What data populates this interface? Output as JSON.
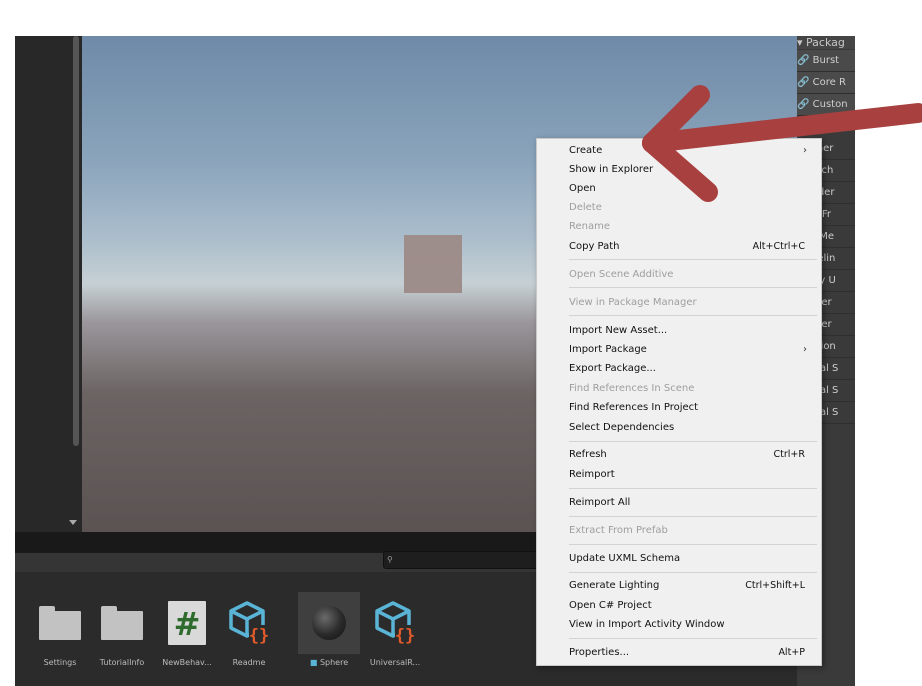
{
  "assets": [
    {
      "label": "Settings",
      "kind": "folder"
    },
    {
      "label": "TutorialInfo",
      "kind": "folder"
    },
    {
      "label": "NewBehav...",
      "kind": "script"
    },
    {
      "label": "Readme",
      "kind": "package"
    },
    {
      "label": "Sphere",
      "kind": "sphere"
    },
    {
      "label": "UniversalR...",
      "kind": "package"
    }
  ],
  "right_panel": {
    "header": "Packag",
    "link_items": [
      "Burst",
      "Core R",
      "Custon"
    ],
    "items": [
      "Gather",
      "Search",
      "Shader",
      "Test Fr",
      "TextMe",
      "Timelin",
      "Unity U",
      "Univer",
      "Univer",
      "Version",
      "Visual S",
      "Visual S",
      "Visual S"
    ]
  },
  "context_menu": {
    "items": [
      {
        "label": "Create",
        "shortcut": "",
        "submenu": true,
        "disabled": false
      },
      {
        "label": "Show in Explorer",
        "shortcut": "",
        "submenu": false,
        "disabled": false
      },
      {
        "label": "Open",
        "shortcut": "",
        "submenu": false,
        "disabled": false
      },
      {
        "label": "Delete",
        "shortcut": "",
        "submenu": false,
        "disabled": true
      },
      {
        "label": "Rename",
        "shortcut": "",
        "submenu": false,
        "disabled": true
      },
      {
        "label": "Copy Path",
        "shortcut": "Alt+Ctrl+C",
        "submenu": false,
        "disabled": false
      },
      {
        "label": "Open Scene Additive",
        "shortcut": "",
        "submenu": false,
        "disabled": true
      },
      {
        "label": "View in Package Manager",
        "shortcut": "",
        "submenu": false,
        "disabled": true
      },
      {
        "label": "Import New Asset...",
        "shortcut": "",
        "submenu": false,
        "disabled": false
      },
      {
        "label": "Import Package",
        "shortcut": "",
        "submenu": true,
        "disabled": false
      },
      {
        "label": "Export Package...",
        "shortcut": "",
        "submenu": false,
        "disabled": false
      },
      {
        "label": "Find References In Scene",
        "shortcut": "",
        "submenu": false,
        "disabled": true
      },
      {
        "label": "Find References In Project",
        "shortcut": "",
        "submenu": false,
        "disabled": false
      },
      {
        "label": "Select Dependencies",
        "shortcut": "",
        "submenu": false,
        "disabled": false
      },
      {
        "label": "Refresh",
        "shortcut": "Ctrl+R",
        "submenu": false,
        "disabled": false
      },
      {
        "label": "Reimport",
        "shortcut": "",
        "submenu": false,
        "disabled": false
      },
      {
        "label": "Reimport All",
        "shortcut": "",
        "submenu": false,
        "disabled": false
      },
      {
        "label": "Extract From Prefab",
        "shortcut": "",
        "submenu": false,
        "disabled": true
      },
      {
        "label": "Update UXML Schema",
        "shortcut": "",
        "submenu": false,
        "disabled": false
      },
      {
        "label": "Generate Lighting",
        "shortcut": "Ctrl+Shift+L",
        "submenu": false,
        "disabled": false
      },
      {
        "label": "Open C# Project",
        "shortcut": "",
        "submenu": false,
        "disabled": false
      },
      {
        "label": "View in Import Activity Window",
        "shortcut": "",
        "submenu": false,
        "disabled": false
      },
      {
        "label": "Properties...",
        "shortcut": "Alt+P",
        "submenu": false,
        "disabled": false
      }
    ],
    "submenu_glyph": "›"
  },
  "colors": {
    "annotation_arrow": "#a8403f",
    "menu_bg": "#f0f0f0",
    "package_icon_blue": "#5ab4d6",
    "package_icon_orange": "#e05a2b",
    "script_hash_green": "#2f6b2f"
  },
  "icons": {
    "search": "search-icon",
    "link": "link-icon"
  }
}
